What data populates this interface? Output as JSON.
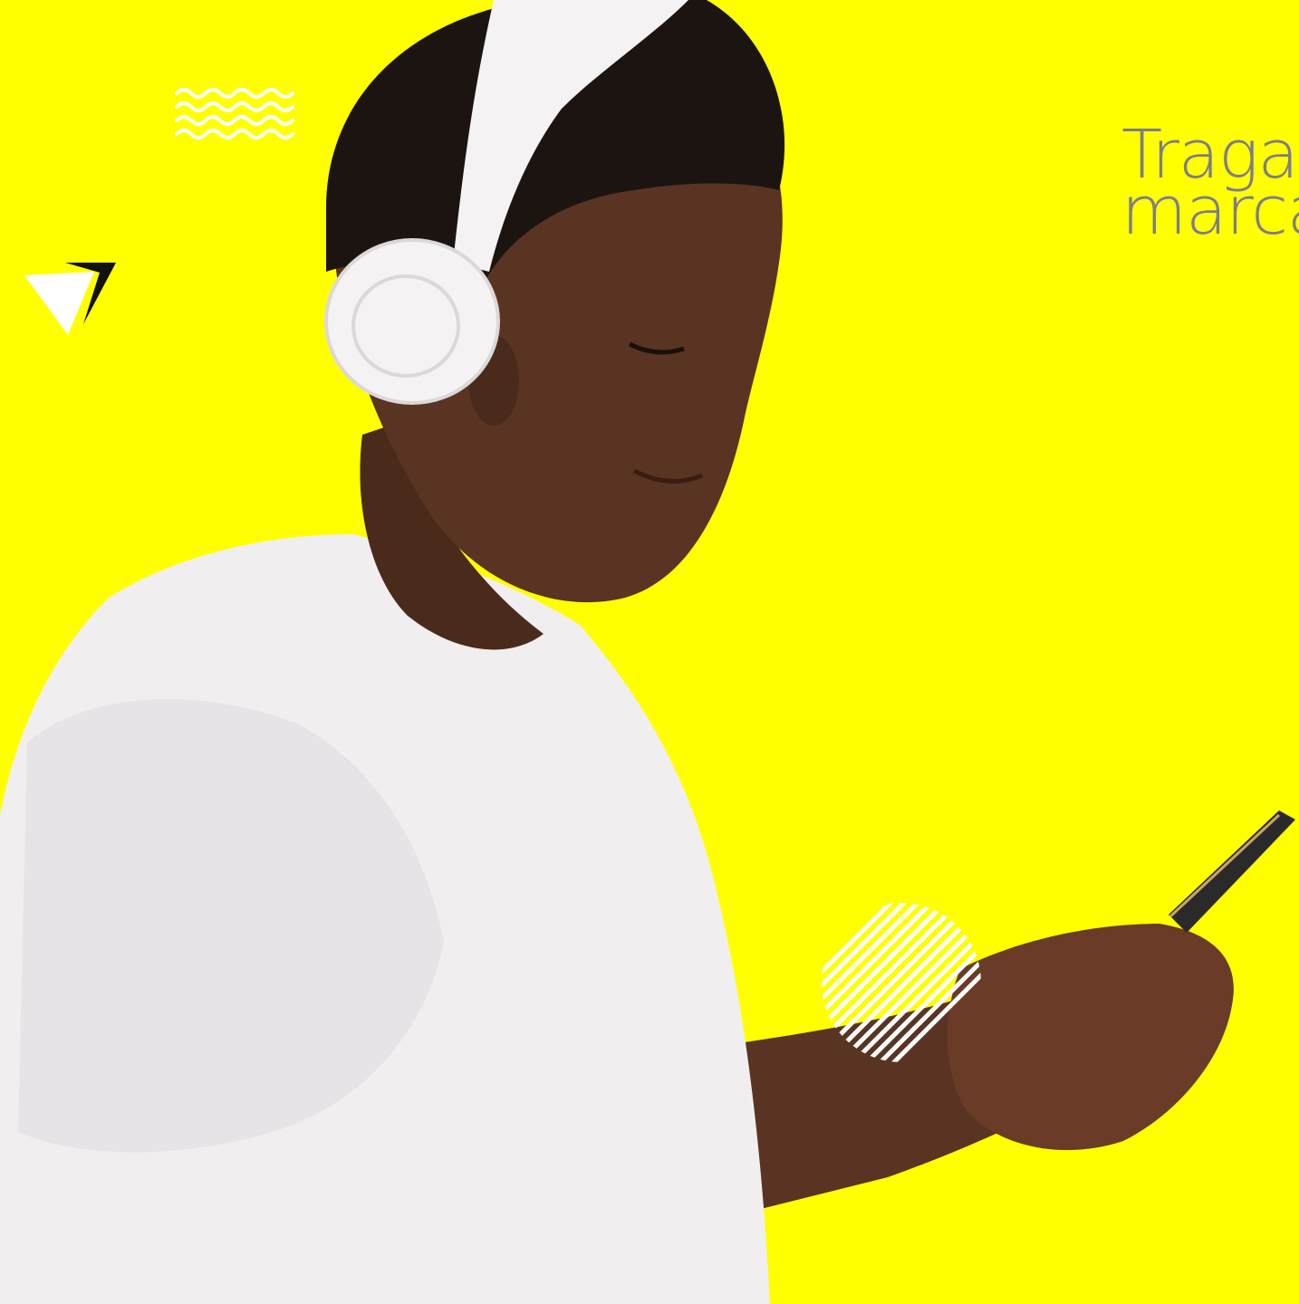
{
  "background_color": "#FFFF00",
  "headline": {
    "line1": "Traga",
    "line2": "marca",
    "color": "#7d7d8a"
  },
  "decorations": {
    "wave_icon": "wave-lines-icon",
    "triangle_icon": "triangle-icon",
    "striped_circle_icon": "striped-circle-icon"
  },
  "photo": {
    "subject": "man-with-headphones-and-phone",
    "skin_color": "#5a3422",
    "shirt_color": "#f1eef0",
    "headphones_color": "#f4f2f3",
    "hair_color": "#1c1410"
  }
}
